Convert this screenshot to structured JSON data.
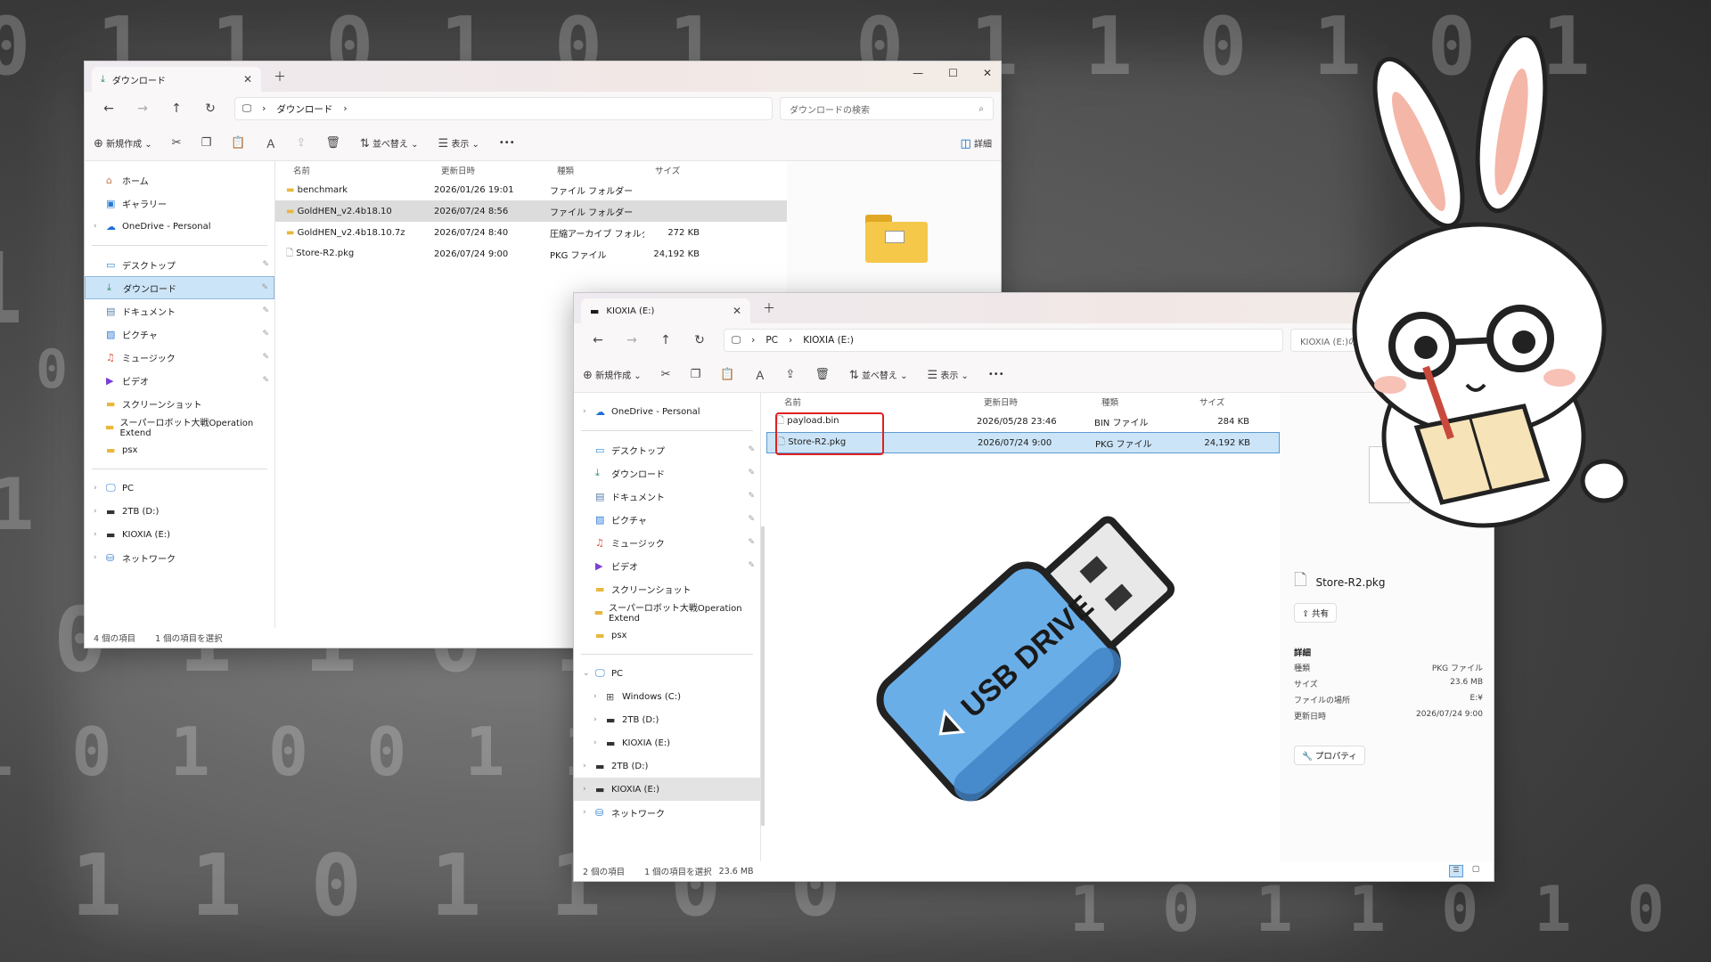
{
  "background": {
    "binary_rows": [
      "0 1 1 0 1 0 1",
      "1 0 1 1 0 1 0",
      "1 1 0 1 0 0 1",
      "0 1 0 1 1 0 1",
      "1 0 0 1 0 1 1",
      "0 1 1 0 1 1 0",
      "1 0 1 0 0 1 1",
      "1 1 0 1 1 0 0"
    ]
  },
  "win1": {
    "tab_title": "ダウンロード",
    "address": {
      "crumbs": [
        "ダウンロード"
      ]
    },
    "search_placeholder": "ダウンロードの検索",
    "toolbar": {
      "new": "新規作成",
      "sort": "並べ替え",
      "view": "表示",
      "more": "•••",
      "detail": "詳細"
    },
    "nav": [
      {
        "label": "ホーム",
        "icon": "home-icon"
      },
      {
        "label": "ギャラリー",
        "icon": "gallery-icon"
      },
      {
        "label": "OneDrive - Personal",
        "icon": "cloud-icon",
        "chev": true
      },
      {
        "sep": true
      },
      {
        "label": "デスクトップ",
        "icon": "desktop-icon",
        "pin": true
      },
      {
        "label": "ダウンロード",
        "icon": "download-icon",
        "pin": true,
        "selected": true
      },
      {
        "label": "ドキュメント",
        "icon": "document-icon",
        "pin": true
      },
      {
        "label": "ピクチャ",
        "icon": "picture-icon",
        "pin": true
      },
      {
        "label": "ミュージック",
        "icon": "music-icon",
        "pin": true
      },
      {
        "label": "ビデオ",
        "icon": "video-icon",
        "pin": true
      },
      {
        "label": "スクリーンショット",
        "icon": "folder-icon"
      },
      {
        "label": "スーパーロボット大戦Operation Extend",
        "icon": "folder-icon"
      },
      {
        "label": "psx",
        "icon": "folder-icon"
      },
      {
        "sep": true
      },
      {
        "label": "PC",
        "icon": "pc-icon",
        "chev": true
      },
      {
        "label": "2TB (D:)",
        "icon": "drive-icon",
        "chev": true
      },
      {
        "label": "KIOXIA (E:)",
        "icon": "drive-icon",
        "chev": true
      },
      {
        "label": "ネットワーク",
        "icon": "network-icon",
        "chev": true
      }
    ],
    "columns": [
      "名前",
      "更新日時",
      "種類",
      "サイズ"
    ],
    "rows": [
      {
        "name": "benchmark",
        "date": "2026/01/26 19:01",
        "type": "ファイル フォルダー",
        "size": "",
        "icon": "folder"
      },
      {
        "name": "GoldHEN_v2.4b18.10",
        "date": "2026/07/24 8:56",
        "type": "ファイル フォルダー",
        "size": "",
        "icon": "folder",
        "hl": true
      },
      {
        "name": "GoldHEN_v2.4b18.10.7z",
        "date": "2026/07/24 8:40",
        "type": "圧縮アーカイブ フォルダー",
        "size": "272 KB",
        "icon": "folder"
      },
      {
        "name": "Store-R2.pkg",
        "date": "2026/07/24 9:00",
        "type": "PKG ファイル",
        "size": "24,192 KB",
        "icon": "file"
      }
    ],
    "status": {
      "count": "4 個の項目",
      "selected": "1 個の項目を選択"
    }
  },
  "win2": {
    "tab_title": "KIOXIA (E:)",
    "address": {
      "crumbs": [
        "PC",
        "KIOXIA (E:)"
      ]
    },
    "search_placeholder": "KIOXIA (E:)の検索",
    "toolbar": {
      "new": "新規作成",
      "sort": "並べ替え",
      "view": "表示",
      "more": "•••"
    },
    "nav": [
      {
        "label": "OneDrive - Personal",
        "icon": "cloud-icon",
        "chev": true
      },
      {
        "sep": true
      },
      {
        "label": "デスクトップ",
        "icon": "desktop-icon",
        "pin": true
      },
      {
        "label": "ダウンロード",
        "icon": "download-icon",
        "pin": true
      },
      {
        "label": "ドキュメント",
        "icon": "document-icon",
        "pin": true
      },
      {
        "label": "ピクチャ",
        "icon": "picture-icon",
        "pin": true
      },
      {
        "label": "ミュージック",
        "icon": "music-icon",
        "pin": true
      },
      {
        "label": "ビデオ",
        "icon": "video-icon",
        "pin": true
      },
      {
        "label": "スクリーンショット",
        "icon": "folder-icon"
      },
      {
        "label": "スーパーロボット大戦Operation Extend",
        "icon": "folder-icon"
      },
      {
        "label": "psx",
        "icon": "folder-icon"
      },
      {
        "sep": true
      },
      {
        "label": "PC",
        "icon": "pc-icon",
        "chev": true,
        "open": true
      },
      {
        "label": "Windows (C:)",
        "icon": "windows-drive-icon",
        "chev": true,
        "indent": true
      },
      {
        "label": "2TB (D:)",
        "icon": "drive-icon",
        "chev": true,
        "indent": true
      },
      {
        "label": "KIOXIA (E:)",
        "icon": "drive-icon",
        "chev": true,
        "indent": true
      },
      {
        "label": "2TB (D:)",
        "icon": "drive-icon",
        "chev": true
      },
      {
        "label": "KIOXIA (E:)",
        "icon": "drive-icon",
        "chev": true,
        "grey": true
      },
      {
        "label": "ネットワーク",
        "icon": "network-icon",
        "chev": true
      }
    ],
    "columns": [
      "名前",
      "更新日時",
      "種類",
      "サイズ"
    ],
    "rows": [
      {
        "name": "payload.bin",
        "date": "2026/05/28 23:46",
        "type": "BIN ファイル",
        "size": "284 KB",
        "icon": "file"
      },
      {
        "name": "Store-R2.pkg",
        "date": "2026/07/24 9:00",
        "type": "PKG ファイル",
        "size": "24,192 KB",
        "icon": "file",
        "selected": true
      }
    ],
    "details": {
      "filename": "Store-R2.pkg",
      "share": "共有",
      "heading": "詳細",
      "props": [
        {
          "k": "種類",
          "v": "PKG ファイル"
        },
        {
          "k": "サイズ",
          "v": "23.6 MB"
        },
        {
          "k": "ファイルの場所",
          "v": "E:¥"
        },
        {
          "k": "更新日時",
          "v": "2026/07/24 9:00"
        }
      ],
      "properties_btn": "プロパティ"
    },
    "status": {
      "count": "2 個の項目",
      "selected": "1 個の項目を選択",
      "size": "23.6 MB"
    }
  },
  "usb": {
    "label": "USB DRIVE",
    "color": "#6aaee8"
  },
  "colors": {
    "highlight_box": "#e02020",
    "selection": "#cce4f7",
    "accent": "#0067c0"
  }
}
